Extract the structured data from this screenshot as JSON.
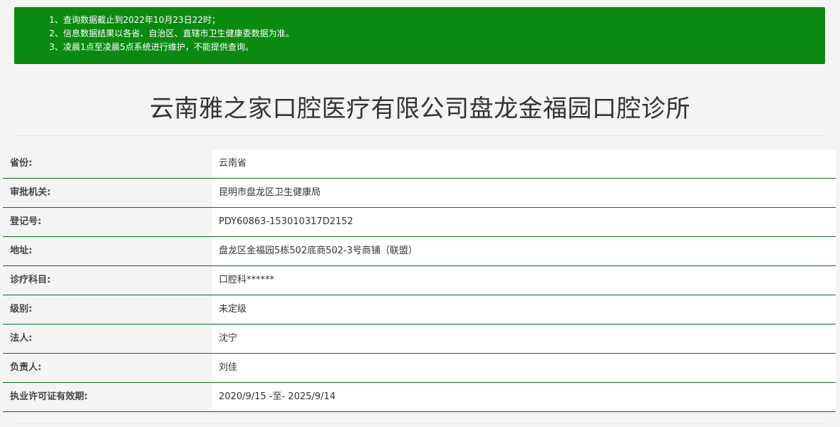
{
  "notice": {
    "lines": [
      "1、查询数据截止到2022年10月23日22时；",
      "2、信息数据结果以各省、自治区、直辖市卫生健康委数据为准。",
      "3、凌晨1点至凌晨5点系统进行维护，不能提供查询。"
    ]
  },
  "title": "云南雅之家口腔医疗有限公司盘龙金福园口腔诊所",
  "rows": [
    {
      "label": "省份:",
      "value": "云南省"
    },
    {
      "label": "审批机关:",
      "value": "昆明市盘龙区卫生健康局"
    },
    {
      "label": "登记号:",
      "value": "PDY60863-153010317D2152"
    },
    {
      "label": "地址:",
      "value": "盘龙区金福园5栋502底商502-3号商铺（联盟）"
    },
    {
      "label": "诊疗科目:",
      "value": "口腔科******"
    },
    {
      "label": "级别:",
      "value": "未定级"
    },
    {
      "label": "法人:",
      "value": "沈宁"
    },
    {
      "label": "负责人:",
      "value": "刘佳"
    },
    {
      "label": "执业许可证有效期:",
      "value": "2020/9/15 -至- 2025/9/14"
    }
  ],
  "colors": {
    "notice_background": "#0b8a12",
    "row_divider": "#0d6b2a",
    "page_background": "#f4f4f4"
  }
}
